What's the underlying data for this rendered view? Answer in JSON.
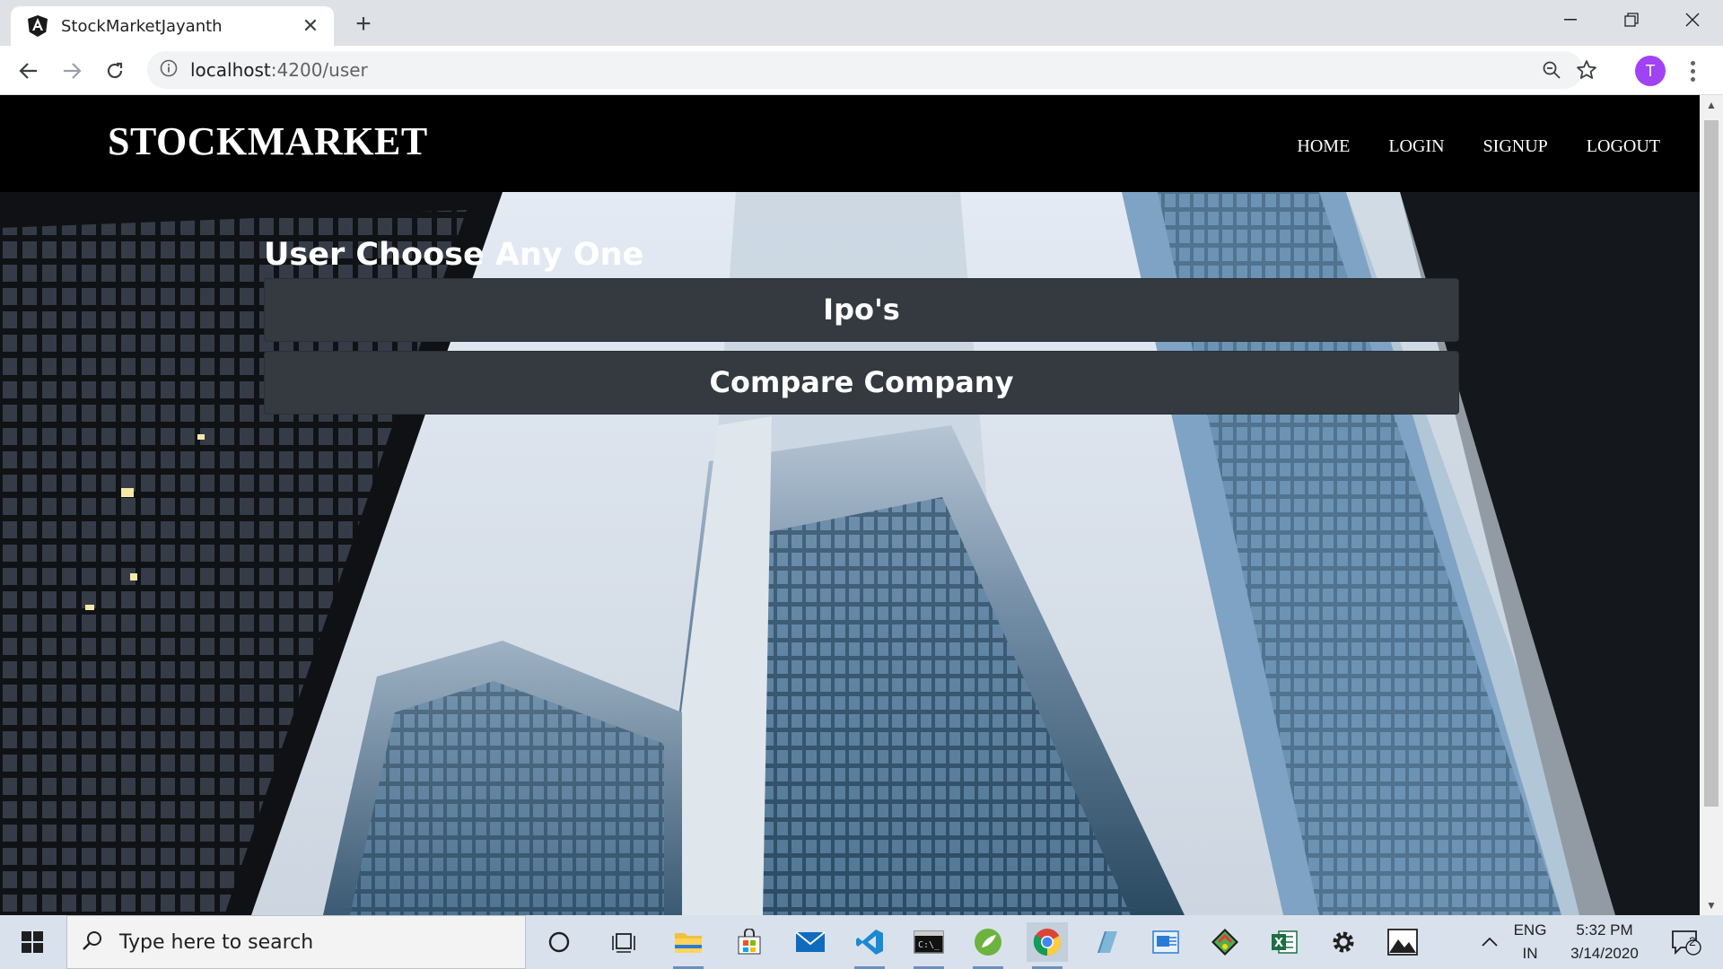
{
  "browser": {
    "tab_title": "StockMarketJayanth",
    "tab_close": "✕",
    "new_tab": "+",
    "url_host": "localhost",
    "url_path": ":4200/user",
    "profile_initial": "T"
  },
  "site": {
    "brand": "STOCKMARKET",
    "nav": [
      "HOME",
      "LOGIN",
      "SIGNUP",
      "LOGOUT"
    ],
    "heading": "User Choose Any One",
    "choices": [
      "Ipo's",
      "Compare Company"
    ]
  },
  "taskbar": {
    "search_placeholder": "Type here to search",
    "language_top": "ENG",
    "language_bottom": "IN",
    "time": "5:32 PM",
    "date": "3/14/2020",
    "notifications": "2",
    "apps": [
      "cortana-icon",
      "task-view-icon",
      "file-explorer-icon",
      "store-icon",
      "mail-icon",
      "vscode-icon",
      "terminal-icon",
      "spring-icon",
      "chrome-icon",
      "notepad-icon",
      "outlook-icon",
      "git-icon",
      "excel-icon",
      "settings-icon",
      "photos-icon"
    ]
  },
  "colors": {
    "navbar": "#000000",
    "button_bg": "#343a40",
    "profile": "#a142f4"
  }
}
